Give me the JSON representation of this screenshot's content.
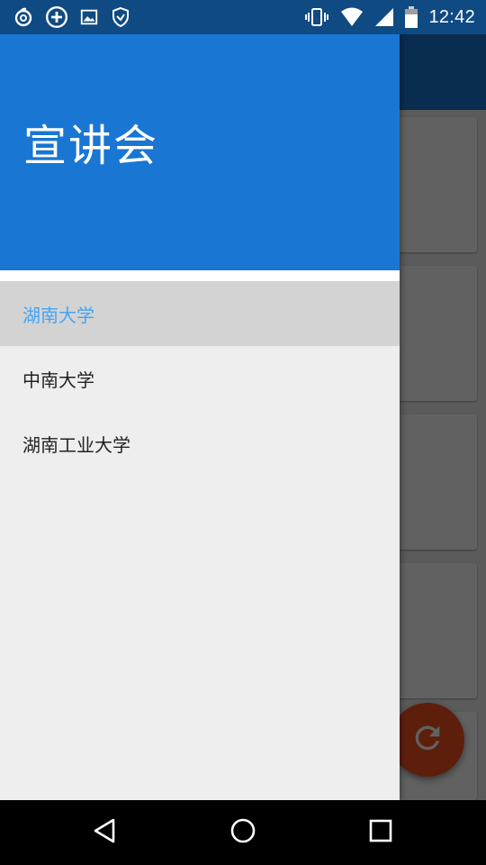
{
  "status_bar": {
    "time": "12:42",
    "left_icons": [
      "netease-music-icon",
      "add-circle-icon",
      "image-icon",
      "shield-icon"
    ],
    "right_icons": [
      "vibrate-icon",
      "wifi-icon",
      "signal-icon",
      "battery-icon"
    ]
  },
  "drawer": {
    "title": "宣讲会",
    "items": [
      {
        "label": "湖南大学",
        "selected": true
      },
      {
        "label": "中南大学",
        "selected": false
      },
      {
        "label": "湖南工业大学",
        "selected": false
      }
    ]
  },
  "colors": {
    "primary": "#1976d2",
    "primary_dark": "#0f4a82",
    "accent": "#f4511e",
    "selected_text": "#42a5f5"
  },
  "fab": {
    "icon": "refresh-icon"
  },
  "nav_bar": {
    "icons": [
      "back-icon",
      "home-icon",
      "recents-icon"
    ]
  }
}
